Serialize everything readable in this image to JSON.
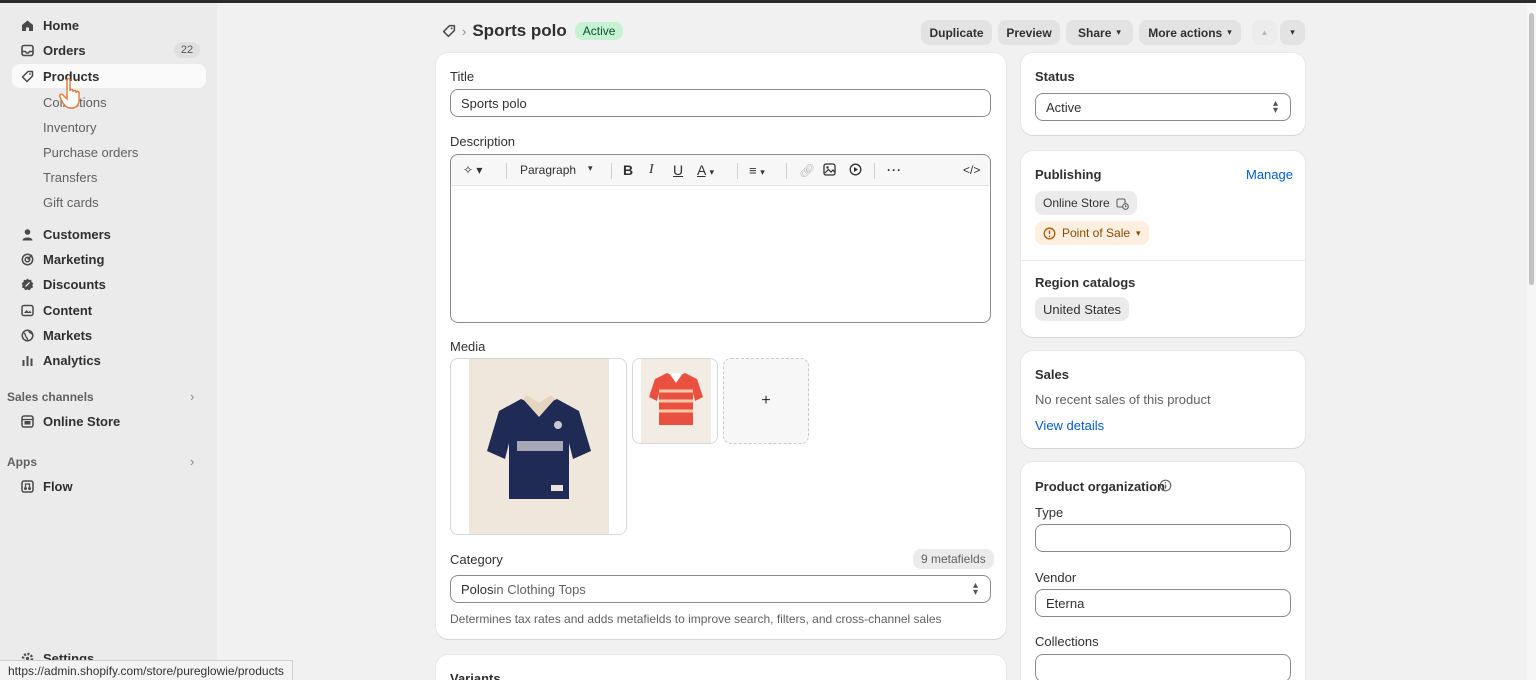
{
  "sidebar": {
    "items": [
      {
        "label": "Home",
        "icon": "home-icon"
      },
      {
        "label": "Orders",
        "icon": "inbox-icon",
        "badge": "22"
      },
      {
        "label": "Products",
        "icon": "tag-icon"
      },
      {
        "label": "Customers",
        "icon": "person-icon"
      },
      {
        "label": "Marketing",
        "icon": "target-icon"
      },
      {
        "label": "Discounts",
        "icon": "discount-icon"
      },
      {
        "label": "Content",
        "icon": "content-icon"
      },
      {
        "label": "Markets",
        "icon": "globe-icon"
      },
      {
        "label": "Analytics",
        "icon": "bar-chart-icon"
      }
    ],
    "product_sub": [
      "Collections",
      "Inventory",
      "Purchase orders",
      "Transfers",
      "Gift cards"
    ],
    "sales_channels_label": "Sales channels",
    "online_store_label": "Online Store",
    "apps_label": "Apps",
    "flow_label": "Flow",
    "settings_label": "Settings"
  },
  "status_url": "https://admin.shopify.com/store/pureglowie/products",
  "header": {
    "title": "Sports polo",
    "status_pill": "Active",
    "duplicate": "Duplicate",
    "preview": "Preview",
    "share": "Share",
    "more_actions": "More actions"
  },
  "main_card": {
    "title_label": "Title",
    "title_value": "Sports polo",
    "description_label": "Description",
    "paragraph_label": "Paragraph",
    "media_label": "Media",
    "add_media": "+",
    "category_label": "Category",
    "metafields_badge": "9 metafields",
    "category_bold": "Polos",
    "category_rest": " in Clothing Tops",
    "category_help": "Determines tax rates and adds metafields to improve search, filters, and cross-channel sales",
    "variants_label": "Variants"
  },
  "status_card": {
    "label": "Status",
    "value": "Active"
  },
  "publishing_card": {
    "label": "Publishing",
    "manage": "Manage",
    "online_store": "Online Store",
    "point_of_sale": "Point of Sale",
    "region_label": "Region catalogs",
    "region_value": "United States"
  },
  "sales_card": {
    "label": "Sales",
    "text": "No recent sales of this product",
    "link": "View details"
  },
  "org_card": {
    "label": "Product organization",
    "type_label": "Type",
    "type_value": "",
    "vendor_label": "Vendor",
    "vendor_value": "Eterna",
    "collections_label": "Collections"
  },
  "colors": {
    "active_pill_bg": "#c5f2d2",
    "active_pill_text": "#0c5132",
    "link": "#005bd3",
    "pos_bg": "#ffefe0",
    "pos_text": "#8a4a00"
  }
}
